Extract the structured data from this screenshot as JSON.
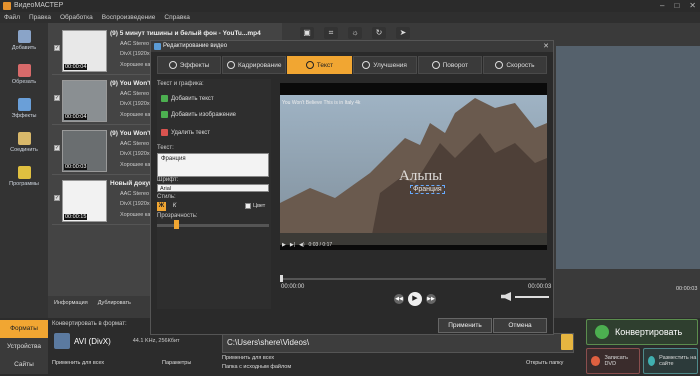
{
  "app": {
    "title": "ВидеоМАСТЕР"
  },
  "menu": [
    "Файл",
    "Правка",
    "Обработка",
    "Воспроизведение",
    "Справка"
  ],
  "sidebar": [
    {
      "label": "Добавить",
      "icon": "add-file-icon"
    },
    {
      "label": "Обрезать",
      "icon": "cut-icon"
    },
    {
      "label": "Эффекты",
      "icon": "effects-icon"
    },
    {
      "label": "Соединить",
      "icon": "join-icon"
    },
    {
      "label": "Программы",
      "icon": "programs-icon"
    }
  ],
  "files": [
    {
      "name": "(9) 5 минут тишины и белый фон - YouTu...mp4",
      "duration": "00:00:04",
      "line1": "AAC Stereo (...",
      "line2": "DivX [1920x...",
      "line3": "Хорошее качество"
    },
    {
      "name": "(9) You Won't...",
      "duration": "00:00:04",
      "line1": "AAC Stereo (...",
      "line2": "DivX [1920x...",
      "line3": "Хорошее качество"
    },
    {
      "name": "(9) You Won't...",
      "duration": "00:00:03",
      "line1": "AAC Stereo (...",
      "line2": "DivX [1920x...",
      "line3": "Хорошее качество"
    },
    {
      "name": "Новый докум...",
      "duration": "00:00:15",
      "line1": "AAC Stereo (...",
      "line2": "DivX [1920x...",
      "line3": "Хорошее качество"
    }
  ],
  "filelist_bar": {
    "info": "Информация",
    "duplicate": "Дублировать"
  },
  "preview_bg": {
    "time": "00:00:03"
  },
  "bottom": {
    "tabs": [
      "Форматы",
      "Устройства",
      "Сайты"
    ],
    "format_label": "Конвертировать в формат:",
    "format_name": "AVI (DivX)",
    "format_info": "44.1 KHz, 256Кбит",
    "apply_all": "Применить для всех",
    "params": "Параметры",
    "path": "C:\\Users\\shere\\Videos\\",
    "apply_all_2": "Применить для всех",
    "source_folder": "Папка с исходным файлом",
    "open_folder": "Открыть папку",
    "convert": "Конвертировать",
    "burn_dvd": "Записать DVD",
    "publish": "Разместить на сайте"
  },
  "dialog": {
    "title": "Редактирование видео",
    "tabs": [
      {
        "label": "Эффекты",
        "icon": "film-icon",
        "active": false
      },
      {
        "label": "Кадрирование",
        "icon": "crop-icon",
        "active": false
      },
      {
        "label": "Текст",
        "icon": "text-icon",
        "active": true
      },
      {
        "label": "Улучшения",
        "icon": "sun-icon",
        "active": false
      },
      {
        "label": "Поворот",
        "icon": "rotate-icon",
        "active": false
      },
      {
        "label": "Скорость",
        "icon": "speed-icon",
        "active": false
      }
    ],
    "text_graphics_label": "Текст и графика:",
    "add_text": "Добавить текст",
    "add_image": "Добавить изображение",
    "delete_text": "Удалить текст",
    "text_label": "Текст:",
    "text_value": "Франция",
    "font_label": "Шрифт:",
    "font_value": "Arial",
    "styles_label": "Стиль:",
    "color_label": "Цвет",
    "opacity_label": "Прозрачность:",
    "video_title": "You Won't Believe This is in Italy 4k",
    "overlay_text": "Альпы",
    "overlay_sub": "Франция",
    "video_time": "0:03 / 0:17",
    "time_start": "00:00:00",
    "time_end": "00:00:03",
    "apply": "Применить",
    "cancel": "Отмена"
  }
}
